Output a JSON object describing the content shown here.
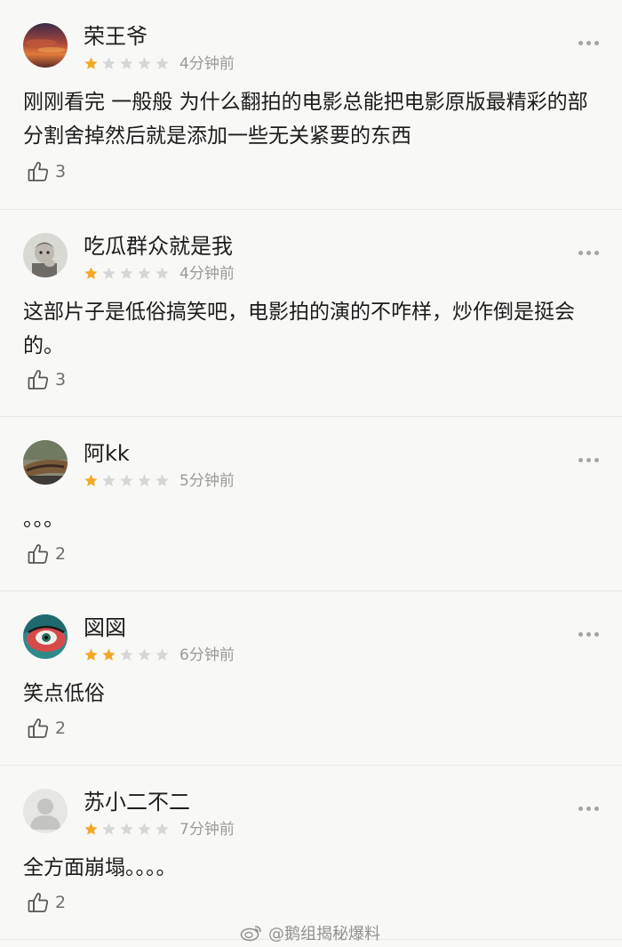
{
  "colors": {
    "star_filled": "#f5a623",
    "star_empty": "#d6d6d6",
    "background": "#f8f8f6",
    "divider": "#e8e8e6"
  },
  "icons": {
    "more": "more-dots-icon",
    "like": "thumbs-up-icon",
    "star": "star-icon"
  },
  "reviews": [
    {
      "username": "荣王爷",
      "rating": 1,
      "max_rating": 5,
      "time": "4分钟前",
      "text": "刚刚看完 一般般 为什么翻拍的电影总能把电影原版最精彩的部分割舍掉然后就是添加一些无关紧要的东西",
      "likes": "3"
    },
    {
      "username": "吃瓜群众就是我",
      "rating": 1,
      "max_rating": 5,
      "time": "4分钟前",
      "text": "这部片子是低俗搞笑吧，电影拍的演的不咋样，炒作倒是挺会的。",
      "likes": "3"
    },
    {
      "username": "阿kk",
      "rating": 1,
      "max_rating": 5,
      "time": "5分钟前",
      "text": "。。。",
      "likes": "2"
    },
    {
      "username": "図図",
      "rating": 2,
      "max_rating": 5,
      "time": "6分钟前",
      "text": "笑点低俗",
      "likes": "2"
    },
    {
      "username": "苏小二不二",
      "rating": 1,
      "max_rating": 5,
      "time": "7分钟前",
      "text": "全方面崩塌。。。。",
      "likes": "2"
    }
  ],
  "watermark": {
    "text": "@鹅组揭秘爆料"
  }
}
